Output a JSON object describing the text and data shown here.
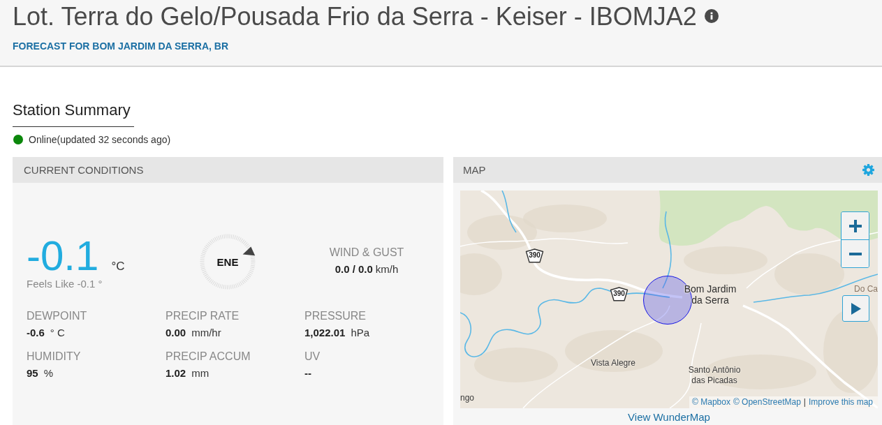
{
  "header": {
    "title": "Lot. Terra do Gelo/Pousada Frio da Serra - Keiser - IBOMJA2",
    "forecast_link": "FORECAST FOR BOM JARDIM DA SERRA, BR"
  },
  "summary": {
    "title": "Station Summary",
    "online": true,
    "status_text": "Online(updated 32 seconds ago)"
  },
  "current_conditions": {
    "title": "CURRENT CONDITIONS",
    "temperature": {
      "value": "-0.1",
      "unit": "°C",
      "feels_like": "Feels Like -0.1 °"
    },
    "wind": {
      "direction": "ENE",
      "label": "WIND & GUST",
      "value": "0.0 / 0.0",
      "unit": "km/h"
    },
    "metrics": [
      {
        "label": "DEWPOINT",
        "value": "-0.6",
        "unit": "° C"
      },
      {
        "label": "PRECIP RATE",
        "value": "0.00",
        "unit": "mm/hr"
      },
      {
        "label": "PRESSURE",
        "value": "1,022.01",
        "unit": "hPa"
      },
      {
        "label": "HUMIDITY",
        "value": "95",
        "unit": "%"
      },
      {
        "label": "PRECIP ACCUM",
        "value": "1.02",
        "unit": "mm"
      },
      {
        "label": "UV",
        "value": "--"
      }
    ]
  },
  "map": {
    "title": "MAP",
    "places": [
      {
        "label": "Bom Jardim da Serra",
        "kind": "town"
      },
      {
        "label": "Vista Alegre",
        "kind": "village"
      },
      {
        "label": "Santo Antônio das Picadas",
        "kind": "village"
      },
      {
        "label": "Do Ca",
        "kind": "area"
      },
      {
        "label": "ngo",
        "kind": "village"
      }
    ],
    "route_shields": [
      "390",
      "390"
    ],
    "attribution": [
      {
        "kind": "link",
        "text": "© Mapbox"
      },
      {
        "kind": "link",
        "text": "© OpenStreetMap"
      },
      {
        "kind": "separator",
        "text": "|"
      },
      {
        "kind": "link",
        "text": "Improve this map"
      }
    ],
    "link": "View WunderMap"
  }
}
